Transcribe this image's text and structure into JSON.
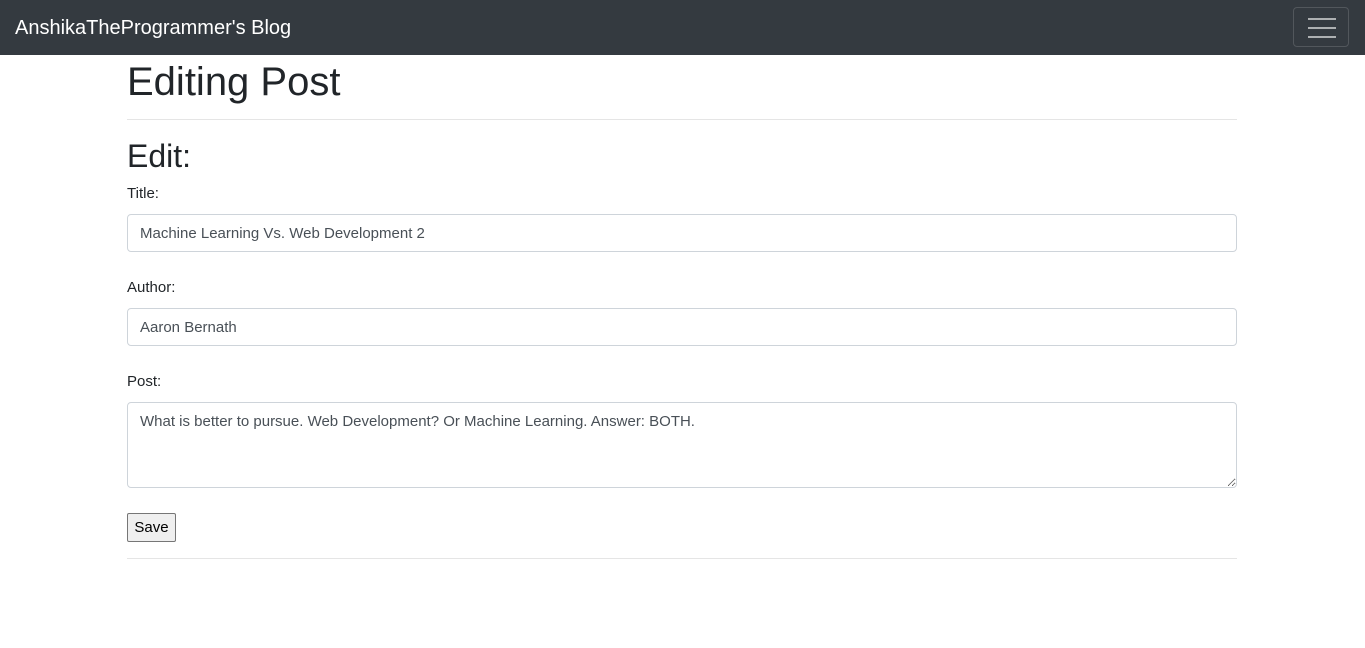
{
  "navbar": {
    "brand": "AnshikaTheProgrammer's Blog",
    "toggler_icon": "hamburger-menu-icon",
    "background": "#343a40"
  },
  "main": {
    "page_title": "Editing Post",
    "section_title": "Edit:",
    "form": {
      "title_label": "Title:",
      "title_value": "Machine Learning Vs. Web Development 2",
      "author_label": "Author:",
      "author_value": "Aaron Bernath",
      "post_label": "Post:",
      "post_value": "What is better to pursue. Web Development? Or Machine Learning. Answer: BOTH.",
      "save_label": "Save"
    }
  }
}
